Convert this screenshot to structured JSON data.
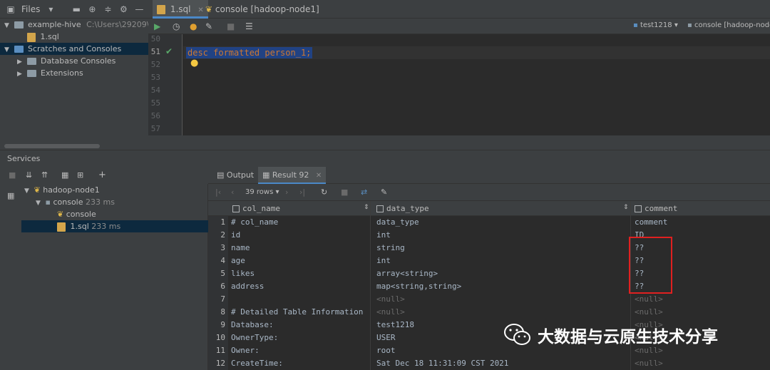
{
  "files_toolbar": {
    "label": "Files"
  },
  "project_tree": {
    "root": {
      "name": "example-hive",
      "path": "C:\\Users\\29209\\De"
    },
    "file": "1.sql",
    "scratches": "Scratches and Consoles",
    "db_consoles": "Database Consoles",
    "extensions": "Extensions"
  },
  "editor_tabs": [
    {
      "label": "1.sql"
    },
    {
      "label": "console [hadoop-node1]"
    }
  ],
  "editor_toolbar": {
    "session": "test1218",
    "datasource": "console [hadoop-node1]"
  },
  "editor": {
    "line_numbers": [
      "50",
      "51",
      "52",
      "53",
      "54",
      "55",
      "56",
      "57"
    ],
    "code_line": "desc formatted person_1;"
  },
  "services": {
    "title": "Services",
    "tree": {
      "node": "hadoop-node1",
      "console": "console",
      "console_time": "233 ms",
      "console_child": "console",
      "file": "1.sql",
      "file_time": "233 ms"
    }
  },
  "result": {
    "tabs": [
      {
        "label": "Output"
      },
      {
        "label": "Result 92"
      }
    ],
    "rows_label": "39 rows",
    "columns": [
      "col_name",
      "data_type",
      "comment"
    ],
    "rows": [
      {
        "n": "1",
        "col_name": "# col_name",
        "data_type": "data_type",
        "comment": "comment"
      },
      {
        "n": "2",
        "col_name": "id",
        "data_type": "int",
        "comment": "ID"
      },
      {
        "n": "3",
        "col_name": "name",
        "data_type": "string",
        "comment": "??"
      },
      {
        "n": "4",
        "col_name": "age",
        "data_type": "int",
        "comment": "??"
      },
      {
        "n": "5",
        "col_name": "likes",
        "data_type": "array<string>",
        "comment": "??"
      },
      {
        "n": "6",
        "col_name": "address",
        "data_type": "map<string,string>",
        "comment": "??"
      },
      {
        "n": "7",
        "col_name": "",
        "data_type": "<null>",
        "comment": "<null>"
      },
      {
        "n": "8",
        "col_name": "# Detailed Table Information",
        "data_type": "<null>",
        "comment": "<null>"
      },
      {
        "n": "9",
        "col_name": "Database:",
        "data_type": "test1218",
        "comment": "<null>"
      },
      {
        "n": "10",
        "col_name": "OwnerType:",
        "data_type": "USER",
        "comment": "<null>"
      },
      {
        "n": "11",
        "col_name": "Owner:",
        "data_type": "root",
        "comment": "<null>"
      },
      {
        "n": "12",
        "col_name": "CreateTime:",
        "data_type": "Sat Dec 18 11:31:09 CST 2021",
        "comment": "<null>"
      }
    ]
  },
  "watermark": {
    "text": "大数据与云原生技术分享"
  },
  "colors": {
    "highlight_box": "#e02020",
    "selection": "#214283",
    "accent": "#4a88c7"
  }
}
